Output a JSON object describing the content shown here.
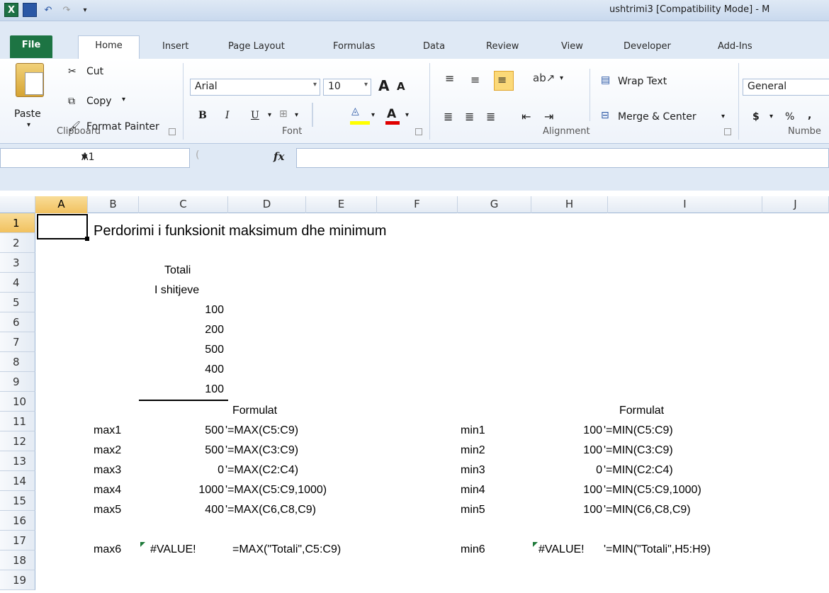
{
  "window": {
    "title": "ushtrimi3  [Compatibility Mode] - M"
  },
  "tabs": [
    "File",
    "Home",
    "Insert",
    "Page Layout",
    "Formulas",
    "Data",
    "Review",
    "View",
    "Developer",
    "Add-Ins"
  ],
  "ribbon": {
    "clipboard": {
      "label": "Clipboard",
      "paste": "Paste",
      "cut": "Cut",
      "copy": "Copy",
      "format_painter": "Format Painter"
    },
    "font": {
      "label": "Font",
      "name": "Arial",
      "size": "10",
      "bold": "B",
      "italic": "I",
      "underline": "U",
      "font_color": "A"
    },
    "alignment": {
      "label": "Alignment",
      "wrap_text": "Wrap Text",
      "merge_center": "Merge & Center"
    },
    "number": {
      "label": "Numbe",
      "format": "General",
      "currency": "$",
      "percent": "%"
    }
  },
  "formula_bar": {
    "name_box": "A1",
    "fx": "fx",
    "content": ""
  },
  "columns": [
    "A",
    "B",
    "C",
    "D",
    "E",
    "F",
    "G",
    "H",
    "I",
    "J"
  ],
  "rows": [
    "1",
    "2",
    "3",
    "4",
    "5",
    "6",
    "7",
    "8",
    "9",
    "10",
    "11",
    "12",
    "13",
    "14",
    "15",
    "16",
    "17",
    "18",
    "19"
  ],
  "sheet": {
    "title": "Perdorimi i funksionit maksimum dhe minimum",
    "header1": "Totali",
    "header2": "I shitjeve",
    "values": [
      "100",
      "200",
      "500",
      "400",
      "100"
    ],
    "formulat_left": "Formulat",
    "formulat_right": "Formulat",
    "max_rows": [
      {
        "label": "max1",
        "value": "500",
        "formula": "'=MAX(C5:C9)"
      },
      {
        "label": "max2",
        "value": "500",
        "formula": "'=MAX(C3:C9)"
      },
      {
        "label": "max3",
        "value": "0",
        "formula": "'=MAX(C2:C4)"
      },
      {
        "label": "max4",
        "value": "1000",
        "formula": "'=MAX(C5:C9,1000)"
      },
      {
        "label": "max5",
        "value": "400",
        "formula": "'=MAX(C6,C8,C9)"
      },
      {
        "label": "max6",
        "value": "#VALUE!",
        "formula": "=MAX(\"Totali\",C5:C9)"
      }
    ],
    "min_rows": [
      {
        "label": "min1",
        "value": "100",
        "formula": "'=MIN(C5:C9)"
      },
      {
        "label": "min2",
        "value": "100",
        "formula": "'=MIN(C3:C9)"
      },
      {
        "label": "min3",
        "value": "0",
        "formula": "'=MIN(C2:C4)"
      },
      {
        "label": "min4",
        "value": "100",
        "formula": "'=MIN(C5:C9,1000)"
      },
      {
        "label": "min5",
        "value": "100",
        "formula": "'=MIN(C6,C8,C9)"
      },
      {
        "label": "min6",
        "value": "#VALUE!",
        "formula": "'=MIN(\"Totali\",H5:H9)"
      }
    ]
  }
}
